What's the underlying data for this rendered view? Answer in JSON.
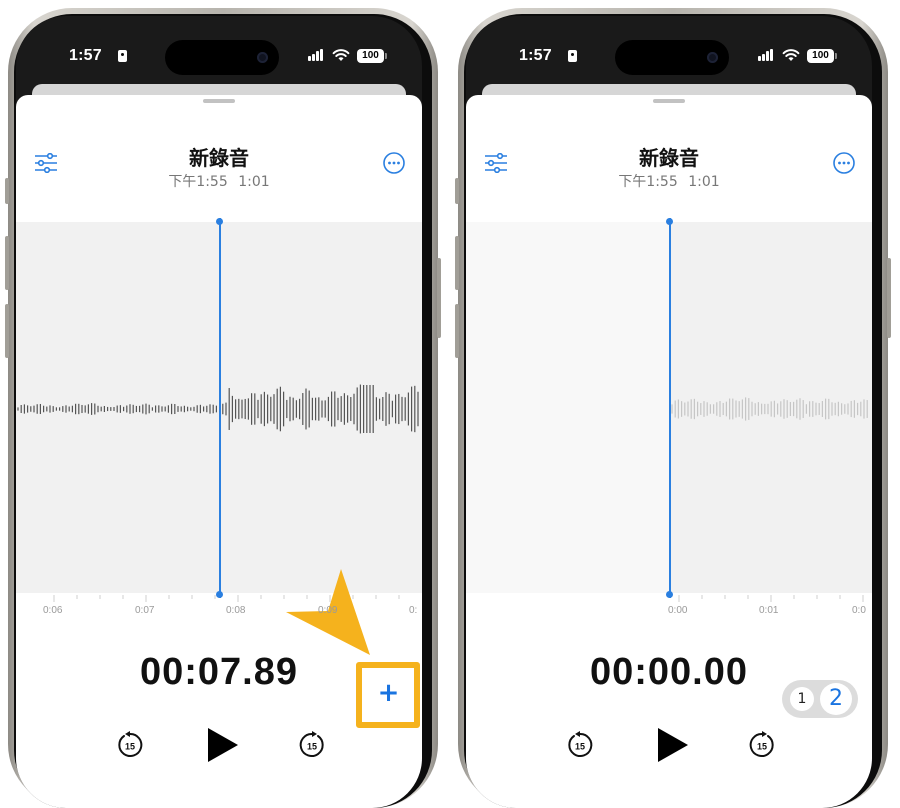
{
  "colors": {
    "accent": "#2a7fe0",
    "highlight": "#f5b21d",
    "waveform": "#555555"
  },
  "phones": [
    {
      "status": {
        "time": "1:57",
        "battery": "100"
      },
      "header": {
        "title": "新錄音",
        "date": "下午1:55",
        "duration": "1:01"
      },
      "ruler_labels": [
        "0:06",
        "0:07",
        "0:08",
        "0:09",
        "0:"
      ],
      "timer": "00:07.89",
      "controls": {
        "skip_back": "15",
        "skip_forward": "15"
      },
      "insert_button": "+"
    },
    {
      "status": {
        "time": "1:57",
        "battery": "100"
      },
      "header": {
        "title": "新錄音",
        "date": "下午1:55",
        "duration": "1:01"
      },
      "ruler_labels": [
        "0:00",
        "0:01",
        "0:0"
      ],
      "timer": "00:00.00",
      "controls": {
        "skip_back": "15",
        "skip_forward": "15"
      },
      "track_toggle": [
        "1",
        "2"
      ]
    }
  ]
}
